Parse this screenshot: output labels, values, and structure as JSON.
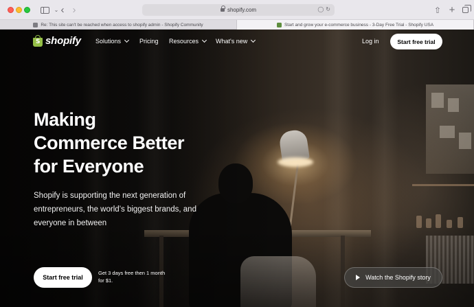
{
  "browser": {
    "url": "shopify.com",
    "tabs": [
      {
        "title": "Re: This site can't be reached when access to shopify admin - Shopify Community",
        "active": false,
        "favicon": "community-favicon"
      },
      {
        "title": "Start and grow your e-commerce business - 3-Day Free Trial - Shopify USA",
        "active": true,
        "favicon": "shopify-favicon"
      }
    ]
  },
  "nav": {
    "logo_text": "shopify",
    "items": [
      {
        "label": "Solutions",
        "has_dropdown": true
      },
      {
        "label": "Pricing",
        "has_dropdown": false
      },
      {
        "label": "Resources",
        "has_dropdown": true
      },
      {
        "label": "What's new",
        "has_dropdown": true
      }
    ],
    "login_label": "Log in",
    "cta_label": "Start free trial"
  },
  "hero": {
    "title_lines": [
      "Making",
      "Commerce Better",
      "for Everyone"
    ],
    "subtitle_lines": [
      "Shopify is supporting the next generation of",
      "entrepreneurs, the world’s biggest brands, and",
      "everyone in between"
    ],
    "cta_label": "Start free trial",
    "trial_note_lines": [
      "Get 3 days free then 1 month",
      "for $1."
    ],
    "watch_label": "Watch the Shopify story"
  },
  "colors": {
    "brand_green": "#95bf47",
    "cta_background": "#ffffff",
    "text": "#ffffff"
  },
  "icons": {
    "browser": [
      "sidebar-toggle-icon",
      "back-icon",
      "forward-icon",
      "lock-icon",
      "translate-icon",
      "reload-icon",
      "share-icon",
      "new-tab-icon",
      "tab-overview-icon"
    ],
    "page": [
      "shopify-bag-icon",
      "chevron-down-icon",
      "play-icon"
    ]
  }
}
